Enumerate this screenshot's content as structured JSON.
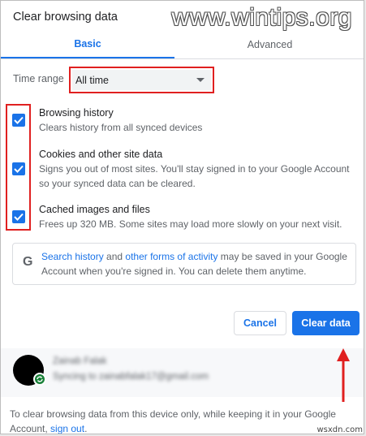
{
  "dialog": {
    "title": "Clear browsing data",
    "watermark": "www.wintips.org"
  },
  "tabs": [
    {
      "label": "Basic",
      "selected": true
    },
    {
      "label": "Advanced",
      "selected": false
    }
  ],
  "time_range": {
    "label": "Time range",
    "value": "All time"
  },
  "options": [
    {
      "title": "Browsing history",
      "desc": "Clears history from all synced devices",
      "checked": true
    },
    {
      "title": "Cookies and other site data",
      "desc": "Signs you out of most sites. You'll stay signed in to your Google Account so your synced data can be cleared.",
      "checked": true
    },
    {
      "title": "Cached images and files",
      "desc": "Frees up 320 MB. Some sites may load more slowly on your next visit.",
      "checked": true
    }
  ],
  "info": {
    "icon_letter": "G",
    "link1": "Search history",
    "text1": " and ",
    "link2": "other forms of activity",
    "text2": " may be saved in your Google Account when you're signed in. You can delete them anytime."
  },
  "buttons": {
    "cancel": "Cancel",
    "clear": "Clear data"
  },
  "account": {
    "name": "Zainab Falak",
    "email": "Syncing to zainabfalak17@gmail.com"
  },
  "footer": {
    "text": "To clear browsing data from this device only, while keeping it in your Google Account, ",
    "link": "sign out",
    "end": "."
  },
  "corner_mark": "wsxdn.com",
  "colors": {
    "accent": "#1a73e8",
    "highlight": "#e02020"
  }
}
